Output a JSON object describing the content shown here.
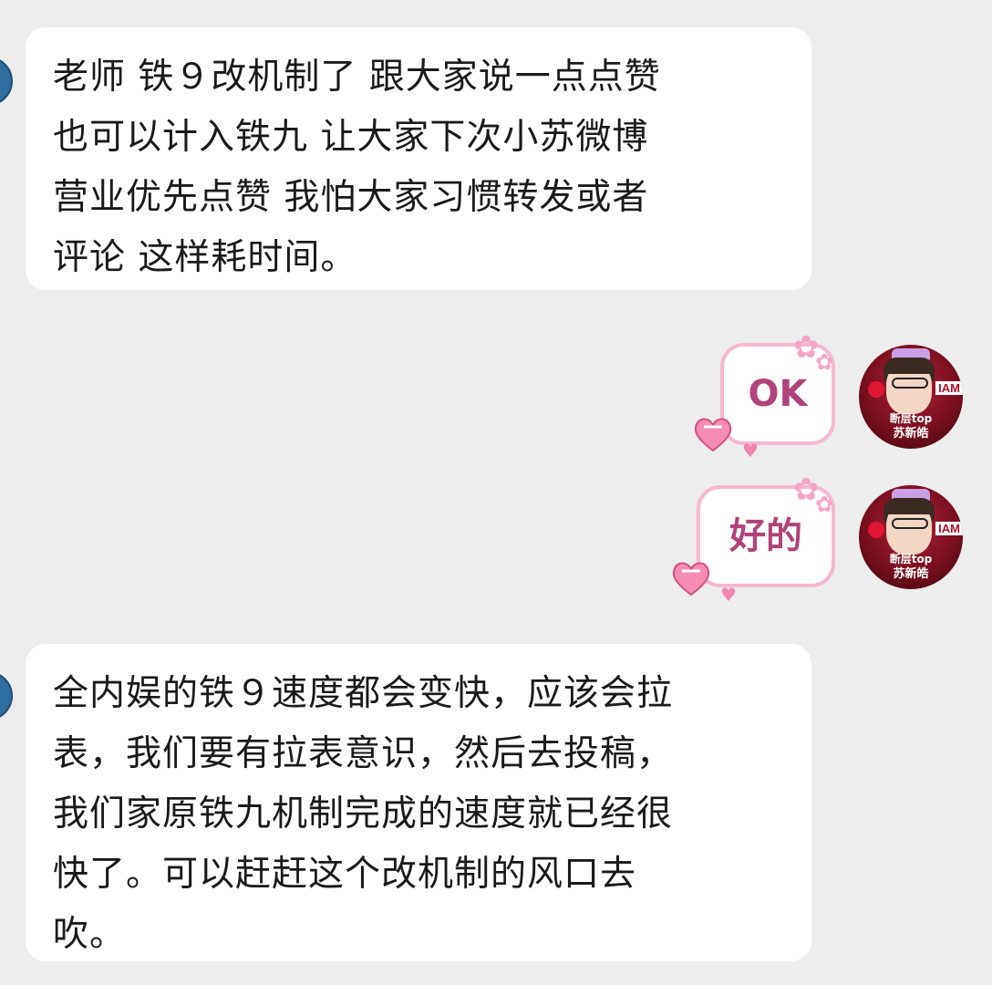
{
  "messages": [
    {
      "side": "incoming",
      "text": "老师 铁９改机制了 跟大家说一点点赞\n也可以计入铁九 让大家下次小苏微博\n营业优先点赞 我怕大家习惯转发或者\n评论 这样耗时间。"
    },
    {
      "side": "outgoing",
      "text": "OK"
    },
    {
      "side": "outgoing",
      "text": "好的"
    },
    {
      "side": "incoming",
      "text": "全内娱的铁９速度都会变快，应该会拉\n表，我们要有拉表意识，然后去投稿，\n我们家原铁九机制完成的速度就已经很\n快了。可以赶赶这个改机制的风口去\n吹。"
    }
  ],
  "my_avatar": {
    "badge": "IAM",
    "caption_line1": "断层top",
    "caption_line2": "苏新皓"
  },
  "colors": {
    "background": "#ededed",
    "incoming_bubble": "#ffffff",
    "outgoing_border": "#f6b8cf",
    "outgoing_text": "#b0447a"
  }
}
